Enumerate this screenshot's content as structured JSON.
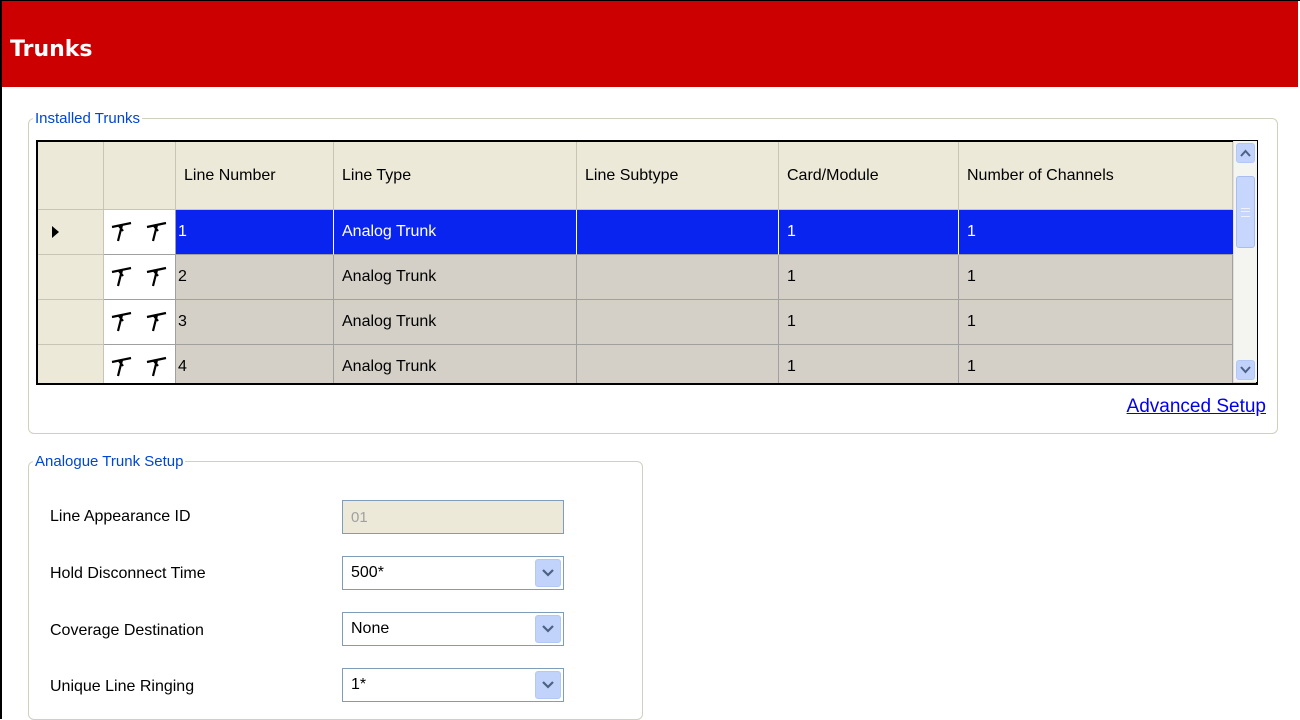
{
  "title": "Trunks",
  "installed_trunks": {
    "legend": "Installed Trunks",
    "columns": [
      "Line Number",
      "Line Type",
      "Line Subtype",
      "Card/Module",
      "Number of Channels"
    ],
    "rows": [
      {
        "line_number": "1",
        "line_type": "Analog Trunk",
        "line_subtype": "",
        "card_module": "1",
        "channels": "1",
        "selected": true
      },
      {
        "line_number": "2",
        "line_type": "Analog Trunk",
        "line_subtype": "",
        "card_module": "1",
        "channels": "1",
        "selected": false
      },
      {
        "line_number": "3",
        "line_type": "Analog Trunk",
        "line_subtype": "",
        "card_module": "1",
        "channels": "1",
        "selected": false
      },
      {
        "line_number": "4",
        "line_type": "Analog Trunk",
        "line_subtype": "",
        "card_module": "1",
        "channels": "1",
        "selected": false
      }
    ],
    "advanced_link": "Advanced Setup"
  },
  "analogue_setup": {
    "legend": "Analogue Trunk Setup",
    "line_appearance_label": "Line Appearance ID",
    "line_appearance_value": "01",
    "hold_disconnect_label": "Hold Disconnect Time",
    "hold_disconnect_value": "500*",
    "coverage_label": "Coverage Destination",
    "coverage_value": "None",
    "ringing_label": "Unique Line Ringing",
    "ringing_value": "1*"
  },
  "colors": {
    "title_bar": "#cc0000",
    "selection": "#0a24f0",
    "legend": "#0046d5",
    "link": "#0000ee"
  },
  "icons": [
    "row-pointer-icon",
    "trunk-line-icon",
    "scroll-up-icon",
    "scroll-down-icon",
    "dropdown-arrow-icon"
  ]
}
